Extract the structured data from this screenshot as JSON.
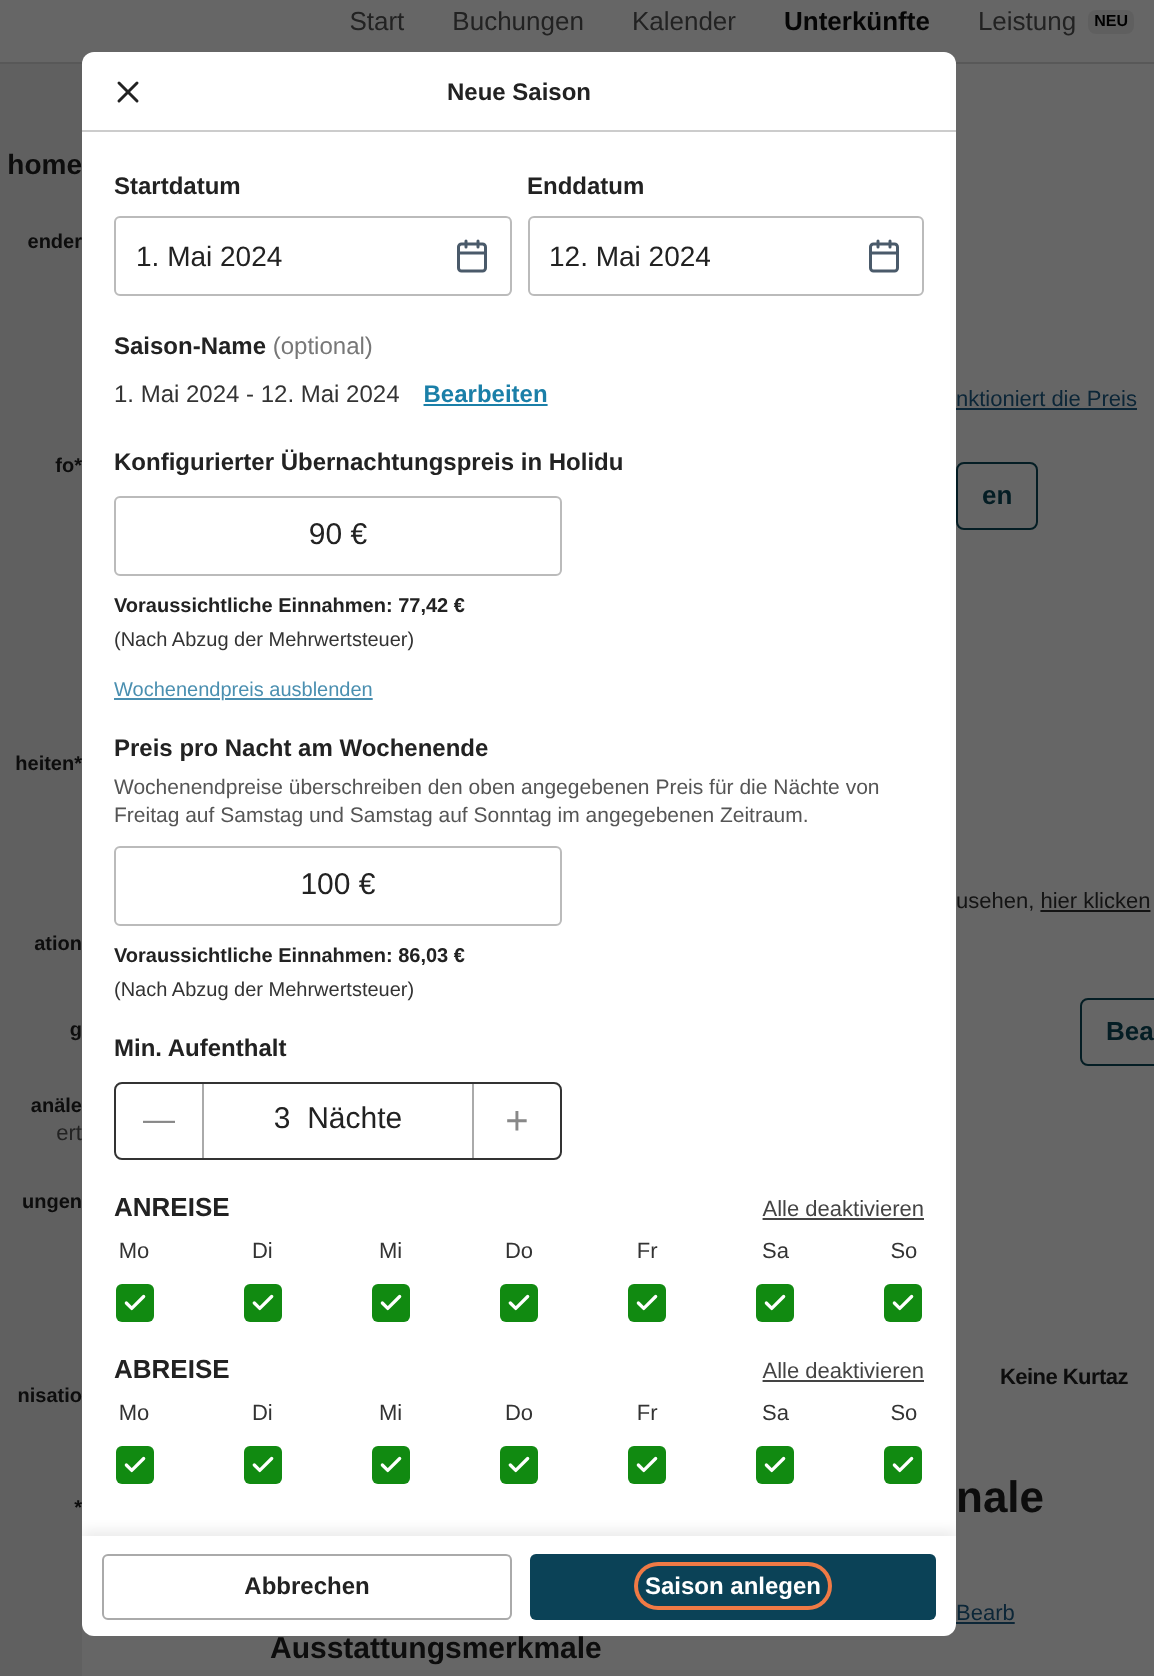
{
  "nav": {
    "tabs": [
      {
        "label": "Start",
        "selected": false
      },
      {
        "label": "Buchungen",
        "selected": false
      },
      {
        "label": "Kalender",
        "selected": false
      },
      {
        "label": "Unterkünfte",
        "selected": true
      },
      {
        "label": "Leistung",
        "selected": false,
        "badge": "NEU"
      }
    ]
  },
  "background": {
    "left": [
      {
        "text": "home",
        "kind": "heading"
      },
      {
        "text": "ender",
        "kind": "label"
      },
      {
        "text": "fo*",
        "kind": "label"
      },
      {
        "text": "heiten*",
        "kind": "label"
      },
      {
        "text": "ation",
        "kind": "label"
      },
      {
        "text": "g",
        "kind": "label"
      },
      {
        "text": "anäle",
        "kind": "label"
      },
      {
        "text": "ert",
        "kind": "sub"
      },
      {
        "text": "ungen",
        "kind": "label"
      },
      {
        "text": "nisatio",
        "kind": "label"
      },
      {
        "text": "*",
        "kind": "label"
      }
    ],
    "right": [
      {
        "text": "nktioniert die Preis",
        "kind": "link"
      },
      {
        "text": "en",
        "kind": "button"
      },
      {
        "text": "usehen, ",
        "link": "hier klicken",
        "kind": "sentence"
      },
      {
        "text": "Bea",
        "kind": "button"
      },
      {
        "text": "Keine Kurtaz",
        "kind": "bold"
      },
      {
        "text": "nale",
        "kind": "heading"
      },
      {
        "text": "Bearb",
        "kind": "link"
      }
    ],
    "bottom": "Ausstattungsmerkmale"
  },
  "modal": {
    "title": "Neue Saison",
    "start": {
      "label": "Startdatum",
      "value": "1. Mai 2024"
    },
    "end": {
      "label": "Enddatum",
      "value": "12. Mai 2024"
    },
    "season_name": {
      "label": "Saison-Name",
      "hint": "(optional)",
      "value": "1. Mai 2024 - 12. Mai 2024",
      "action": "Bearbeiten"
    },
    "price": {
      "label": "Konfigurierter Übernachtungspreis in Holidu",
      "value": "90 €",
      "revenue": "Voraussichtliche Einnahmen: 77,42 €",
      "note": "(Nach Abzug der Mehrwertsteuer)"
    },
    "weekend_toggle": "Wochenendpreis ausblenden",
    "weekend": {
      "label": "Preis pro Nacht am Wochenende",
      "description": "Wochenendpreise überschreiben den oben angegebenen Preis für die Nächte von Freitag auf Samstag und Samstag auf Sonntag im angegebenen Zeitraum.",
      "value": "100 €",
      "revenue": "Voraussichtliche Einnahmen: 86,03 €",
      "note": "(Nach Abzug der Mehrwertsteuer)"
    },
    "min_stay": {
      "label": "Min. Aufenthalt",
      "minus": "—",
      "value": "3  Nächte",
      "plus": "+"
    },
    "day_groups": [
      {
        "title": "ANREISE",
        "action": "Alle deaktivieren",
        "days": [
          {
            "label": "Mo",
            "checked": true
          },
          {
            "label": "Di",
            "checked": true
          },
          {
            "label": "Mi",
            "checked": true
          },
          {
            "label": "Do",
            "checked": true
          },
          {
            "label": "Fr",
            "checked": true
          },
          {
            "label": "Sa",
            "checked": true
          },
          {
            "label": "So",
            "checked": true
          }
        ]
      },
      {
        "title": "ABREISE",
        "action": "Alle deaktivieren",
        "days": [
          {
            "label": "Mo",
            "checked": true
          },
          {
            "label": "Di",
            "checked": true
          },
          {
            "label": "Mi",
            "checked": true
          },
          {
            "label": "Do",
            "checked": true
          },
          {
            "label": "Fr",
            "checked": true
          },
          {
            "label": "Sa",
            "checked": true
          },
          {
            "label": "So",
            "checked": true
          }
        ]
      }
    ],
    "cancel": "Abbrechen",
    "submit": {
      "label": "Saison anlegen",
      "focused": true
    }
  }
}
